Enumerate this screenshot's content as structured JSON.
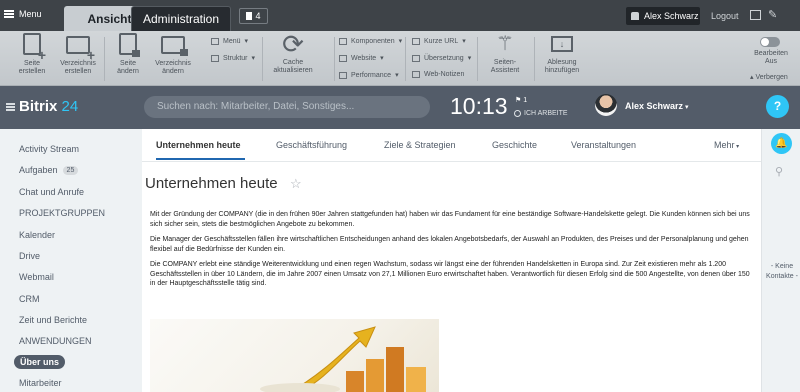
{
  "admin_bar": {
    "menu_label": "Menu",
    "tab_view": "Ansicht",
    "tab_admin": "Administration",
    "notifications_count": "4",
    "user_name": "Alex Schwarz",
    "logout_label": "Logout"
  },
  "admin_toolbar": {
    "page_create": "Seite\nerstellen",
    "folder_create": "Verzeichnis\nerstellen",
    "page_edit": "Seite\nändern",
    "folder_edit": "Verzeichnis\nändern",
    "menu_label": "Menü",
    "structure_label": "Struktur",
    "cache_refresh": "Cache\naktualisieren",
    "components_label": "Komponenten",
    "website_label": "Website",
    "performance_label": "Performance",
    "short_url_label": "Kurze URL",
    "translation_label": "Übersetzung",
    "web_notes_label": "Web-Notizen",
    "page_wizard": "Seiten-\nAssistent",
    "record_label": "Ablesung\nhinzufügen",
    "edit_mode": "Bearbeiten\nAus",
    "hide_label": "Verbergen"
  },
  "header": {
    "logo_text": "Bitrix",
    "logo_number": "24",
    "search_placeholder": "Suchen nach: Mitarbeiter, Datei, Sonstiges...",
    "clock_time": "10:13",
    "clock_flag": "1",
    "work_status": "ICH ARBEITE",
    "user_name": "Alex Schwarz",
    "help_label": "?"
  },
  "left_menu": {
    "items": [
      {
        "label": "Activity Stream"
      },
      {
        "label": "Aufgaben",
        "count": "25"
      },
      {
        "label": "Chat und Anrufe"
      },
      {
        "label": "PROJEKTGRUPPEN"
      },
      {
        "label": "Kalender"
      },
      {
        "label": "Drive"
      },
      {
        "label": "Webmail"
      },
      {
        "label": "CRM"
      },
      {
        "label": "Zeit und Berichte"
      },
      {
        "label": "ANWENDUNGEN"
      },
      {
        "label": "Über uns"
      },
      {
        "label": "Mitarbeiter"
      }
    ]
  },
  "main": {
    "tabs": [
      {
        "label": "Unternehmen heute"
      },
      {
        "label": "Geschäftsführung"
      },
      {
        "label": "Ziele & Strategien"
      },
      {
        "label": "Geschichte"
      },
      {
        "label": "Veranstaltungen"
      },
      {
        "label": "Mehr"
      }
    ],
    "page_title": "Unternehmen heute",
    "paragraphs": [
      "Mit der Gründung der COMPANY (die in den frühen 90er Jahren stattgefunden hat) haben wir das Fundament für eine beständige Software-Handelskette gelegt. Die Kunden können sich  bei uns sich sicher sein, stets die bestmöglichen Angebote zu bekommen.",
      "Die Manager der Geschäftsstellen fällen ihre wirtschaftlichen Entscheidungen anhand des lokalen Angebotsbedarfs, der Auswahl an Produkten, des Preises und der Personalplanung und gehen flexibel auf die Bedürfnisse der Kunden ein.",
      "Die COMPANY erlebt eine ständige Weiterentwicklung und einen regen Wachstum, sodass wir längst eine der führenden Handelsketten in Europa sind. Zur Zeit existieren mehr als 1.200 Geschäftsstellen in über 10 Ländern, die im Jahre 2007 einen Umsatz von 27,1 Millionen Euro erwirtschaftet haben. Verantwortlich für diesen Erfolg sind die 500 Angestellte, von denen über 150 in der Hauptgeschäftsstelle tätig sind."
    ]
  },
  "right_panel": {
    "no_contacts": "- Keine\nKontakte -"
  },
  "colors": {
    "accent": "#2fc6f6",
    "header_bg": "#535c69",
    "tab_underline": "#2067b0"
  }
}
